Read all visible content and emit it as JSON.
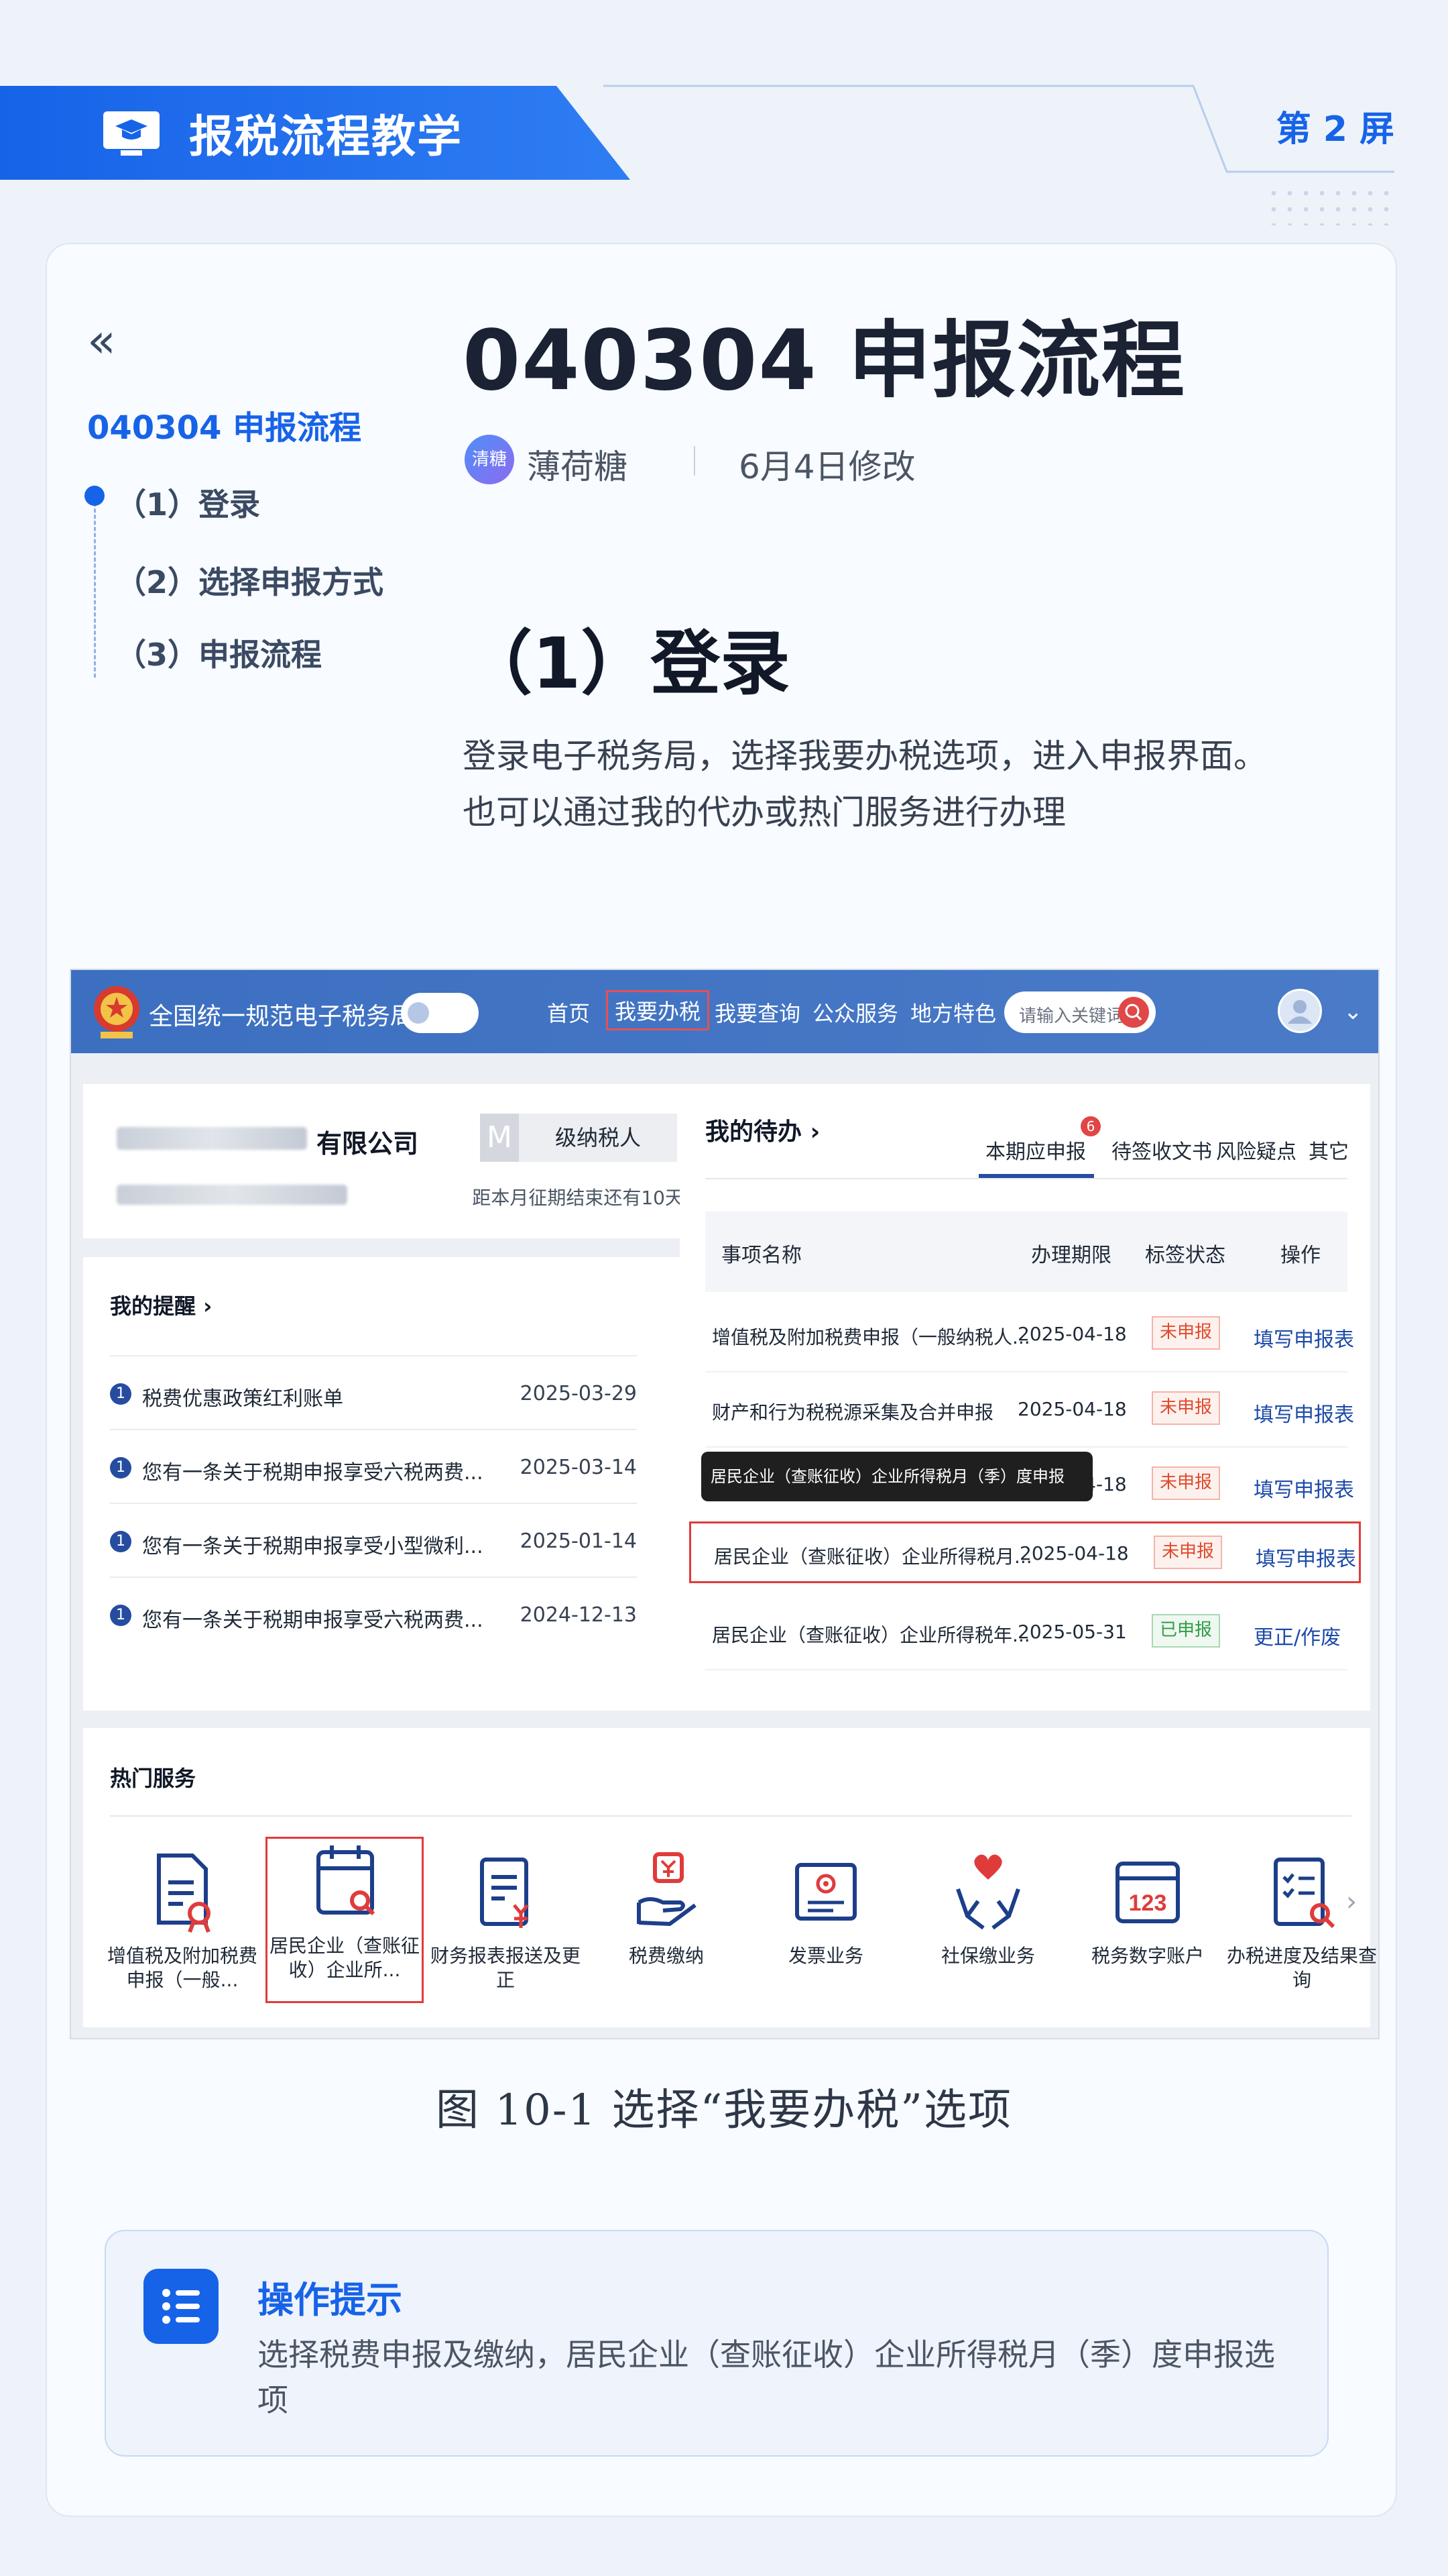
{
  "header": {
    "title": "报税流程教学",
    "screen_label": "第 2 屏"
  },
  "toc": {
    "title": "040304 申报流程",
    "items": [
      "（1）登录",
      "（2）选择申报方式",
      "（3）申报流程"
    ]
  },
  "doc": {
    "title": "040304 申报流程",
    "author_avatar": "清糖",
    "author": "薄荷糖",
    "modified": "6月4日修改",
    "section_heading": "（1）登录",
    "paragraph_lines": [
      "登录电子税务局，选择我要办税选项，进入申报界面。",
      "也可以通过我的代办或热门服务进行办理"
    ]
  },
  "screenshot": {
    "site_name": "全国统一规范电子税务局",
    "nav": [
      "首页",
      "我要办税",
      "我要查询",
      "公众服务",
      "地方特色"
    ],
    "search_placeholder": "请输入关键词",
    "company_suffix": "有限公司",
    "company_badge": "M",
    "taxpayer_level": "级纳税人",
    "deadline_text": "距本月征期结束还有10天",
    "reminders": {
      "title": "我的提醒 ›",
      "rows": [
        {
          "num": "1",
          "text": "税费优惠政策红利账单",
          "date": "2025-03-29"
        },
        {
          "num": "1",
          "text": "您有一条关于税期申报享受六税两费...",
          "date": "2025-03-14"
        },
        {
          "num": "1",
          "text": "您有一条关于税期申报享受小型微利...",
          "date": "2025-01-14"
        },
        {
          "num": "1",
          "text": "您有一条关于税期申报享受六税两费...",
          "date": "2024-12-13"
        }
      ]
    },
    "todo": {
      "title": "我的待办 ›",
      "tabs": [
        "本期应申报",
        "待签收文书",
        "风险疑点",
        "其它"
      ],
      "tab_badge": "6",
      "columns": [
        "事项名称",
        "办理期限",
        "标签状态",
        "操作"
      ],
      "rows": [
        {
          "name": "增值税及附加税费申报（一般纳税人...",
          "deadline": "2025-04-18",
          "status": "未申报",
          "action": "填写申报表"
        },
        {
          "name": "财产和行为税税源采集及合并申报",
          "deadline": "2025-04-18",
          "status": "未申报",
          "action": "填写申报表"
        },
        {
          "name": "",
          "deadline": "2025-04-18",
          "status": "未申报",
          "action": "填写申报表"
        },
        {
          "name": "居民企业（查账征收）企业所得税月...",
          "deadline": "2025-04-18",
          "status": "未申报",
          "action": "填写申报表"
        },
        {
          "name": "居民企业（查账征收）企业所得税年...",
          "deadline": "2025-05-31",
          "status": "已申报",
          "action": "更正/作废"
        }
      ],
      "tooltip": "居民企业（查账征收）企业所得税月（季）度申报"
    },
    "hot_services": {
      "title": "热门服务",
      "items": [
        {
          "label": "增值税及附加税费申报（一般...",
          "icon": "document-stamp-icon"
        },
        {
          "label": "居民企业（查账征收）企业所...",
          "icon": "calendar-search-icon"
        },
        {
          "label": "财务报表报送及更正",
          "icon": "report-yen-icon"
        },
        {
          "label": "税费缴纳",
          "icon": "hand-yen-icon"
        },
        {
          "label": "发票业务",
          "icon": "invoice-icon"
        },
        {
          "label": "社保缴业务",
          "icon": "hands-heart-icon"
        },
        {
          "label": "税务数字账户",
          "icon": "calendar-123-icon"
        },
        {
          "label": "办税进度及结果查询",
          "icon": "checklist-search-icon"
        }
      ]
    }
  },
  "figure_caption": "图 10-1 选择“我要办税”选项",
  "tip": {
    "title": "操作提示",
    "text": "选择税费申报及缴纳，居民企业（查账征收）企业所得税月（季）度申报选项"
  },
  "colors": {
    "accent": "#1763e8",
    "warning": "#e03b3b",
    "portal_blue": "#3c6fc0"
  }
}
